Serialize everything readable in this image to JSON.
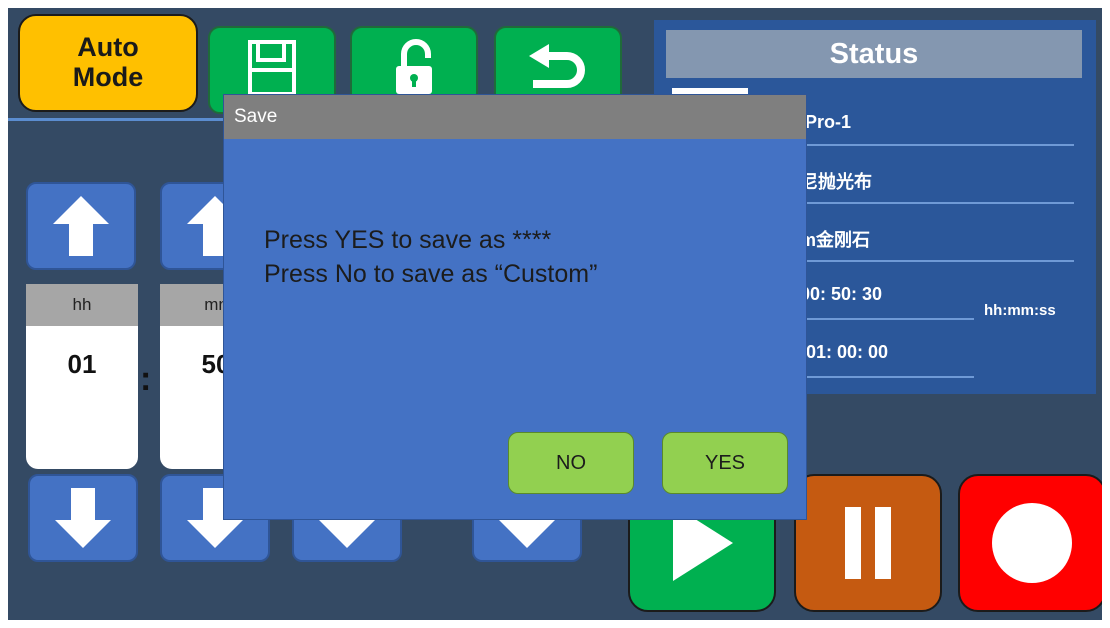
{
  "mode_button": {
    "line1": "Auto",
    "line2": "Mode"
  },
  "toolbar": {
    "save_icon": "floppy-disk-icon",
    "unlock_icon": "unlock-icon",
    "undo_icon": "undo-arrow-icon"
  },
  "status_panel": {
    "title": "Status",
    "rows": [
      {
        "value": "/Pro-1"
      },
      {
        "value": "尼抛光布"
      },
      {
        "value": "m金刚石"
      },
      {
        "value": "00:  50:  30",
        "unit": "hh:mm:ss"
      },
      {
        "value": ")01:  00:  00"
      }
    ]
  },
  "time_setter": {
    "hours": {
      "header": "hh",
      "value": "01"
    },
    "minutes": {
      "header": "mn",
      "value": "50"
    },
    "separator": ":"
  },
  "dialog": {
    "title": "Save",
    "message_line1": "Press YES to save as ****",
    "message_line2": "Press No to save as “Custom”",
    "no_label": "NO",
    "yes_label": "YES"
  },
  "controls": {
    "play_icon": "play-icon",
    "pause_icon": "pause-icon",
    "stop_icon": "stop-circle-icon"
  },
  "colors": {
    "background": "#344a64",
    "auto_mode": "#ffc000",
    "toolbar": "#00b050",
    "status_panel": "#2b579a",
    "dialog": "#4472c4",
    "dialog_buttons": "#92d050",
    "pause": "#c55a11",
    "stop": "#ff0000"
  }
}
